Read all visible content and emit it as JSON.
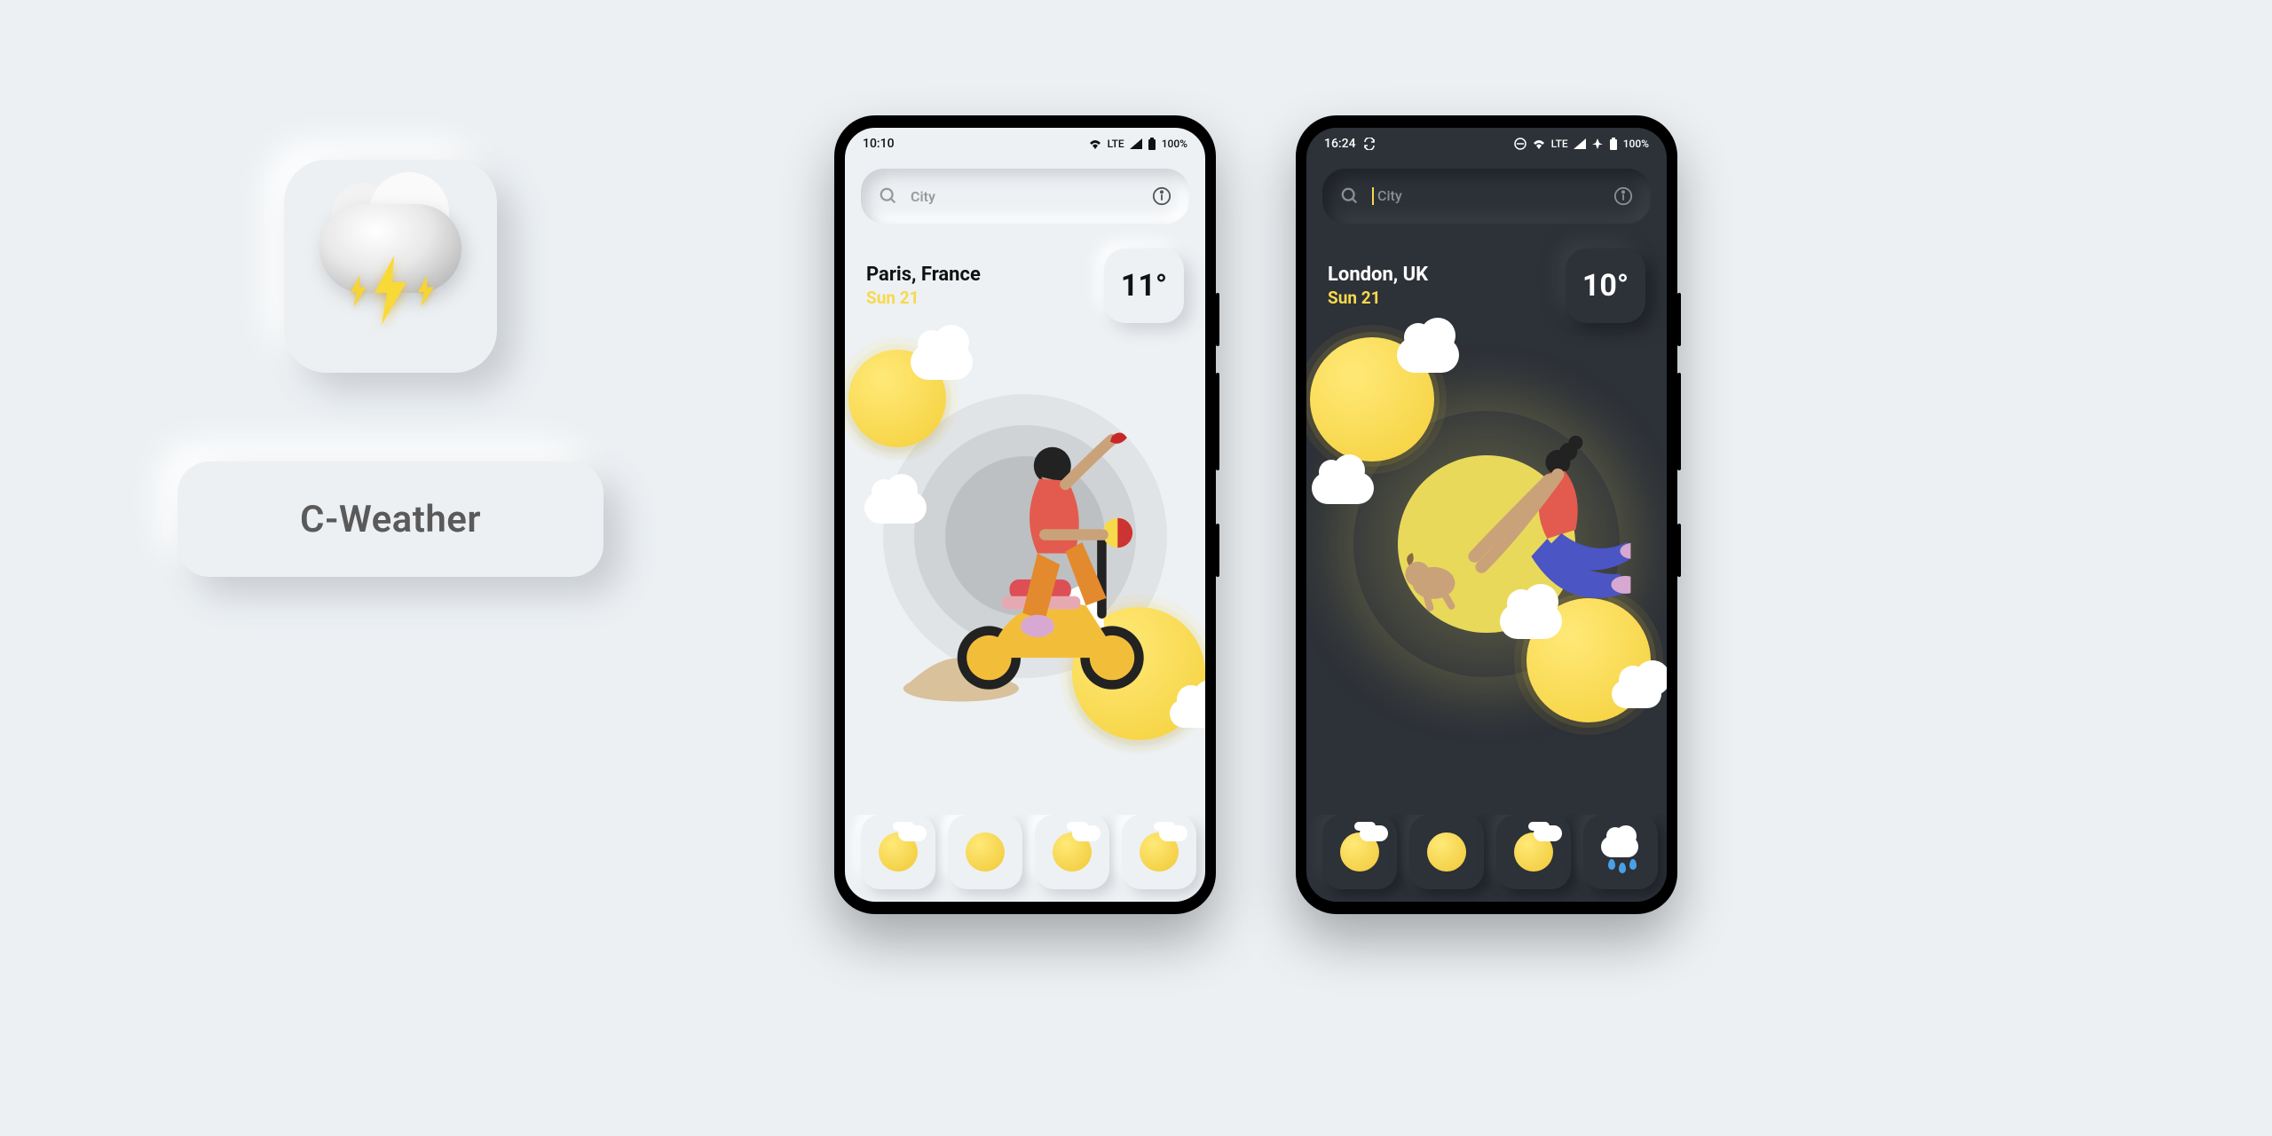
{
  "branding": {
    "app_name": "C-Weather",
    "icon": "storm-cloud-icon"
  },
  "accent_color": "#f7d94c",
  "phones": {
    "light": {
      "status": {
        "time": "10:10",
        "network": "LTE",
        "battery": "100%"
      },
      "search": {
        "placeholder": "City"
      },
      "location": {
        "name": "Paris, France",
        "date": "Sun 21"
      },
      "temperature": "11°",
      "forecast_icons": [
        "partly-cloudy",
        "sunny",
        "partly-cloudy",
        "partly-cloudy"
      ]
    },
    "dark": {
      "status": {
        "time": "16:24",
        "network": "LTE",
        "battery": "100%"
      },
      "search": {
        "placeholder": "City"
      },
      "location": {
        "name": "London, UK",
        "date": "Sun 21"
      },
      "temperature": "10°",
      "forecast_icons": [
        "partly-cloudy",
        "sunny",
        "partly-cloudy",
        "rain"
      ]
    }
  }
}
